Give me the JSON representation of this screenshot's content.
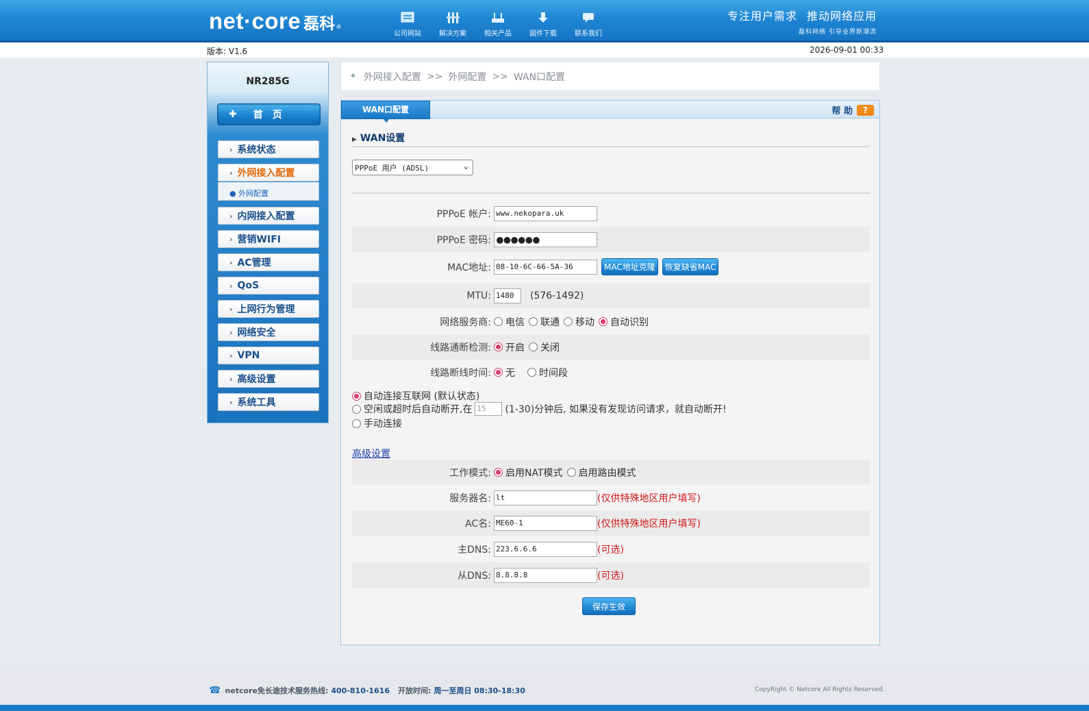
{
  "header": {
    "brand": "net·core",
    "brand_cn": "磊科",
    "reg_mark": "®",
    "nav": [
      {
        "label": "公司网站",
        "icon": "website-icon"
      },
      {
        "label": "解决方案",
        "icon": "tools-icon"
      },
      {
        "label": "相关产品",
        "icon": "router-icon"
      },
      {
        "label": "固件下载",
        "icon": "download-icon"
      },
      {
        "label": "联系我们",
        "icon": "chat-icon"
      }
    ],
    "slogan_1a": "专注用户需求",
    "slogan_1b": "推动网络应用",
    "slogan_2": "磊科网络 引导业界新潮流"
  },
  "infobar": {
    "version": "版本: V1.6",
    "datetime": "2026-09-01 00:33"
  },
  "sidebar": {
    "model": "NR285G",
    "home_label": "首　页",
    "items": [
      {
        "label": "系统状态",
        "active": false
      },
      {
        "label": "外网接入配置",
        "active": true
      },
      {
        "label": "内网接入配置",
        "active": false
      },
      {
        "label": "营销WIFI",
        "active": false
      },
      {
        "label": "AC管理",
        "active": false
      },
      {
        "label": "QoS",
        "active": false
      },
      {
        "label": "上网行为管理",
        "active": false
      },
      {
        "label": "网络安全",
        "active": false
      },
      {
        "label": "VPN",
        "active": false
      },
      {
        "label": "高级设置",
        "active": false
      },
      {
        "label": "系统工具",
        "active": false
      }
    ],
    "submenu_label": "● 外网配置"
  },
  "breadcrumb": {
    "crumbs": [
      "外网接入配置",
      "外网配置",
      "WAN口配置"
    ],
    "sep": ">>"
  },
  "panel": {
    "tab_label": "WAN口配置",
    "help_label": "帮 助",
    "help_icon": "?",
    "section_title": "WAN设置",
    "connection_type": "PPPoE 用户 (ADSL)",
    "pppoe_account_label": "PPPoE 帐户:",
    "pppoe_account": "www.nekopara.uk",
    "pppoe_password_label": "PPPoE 密码:",
    "pppoe_password": "●●●●●●",
    "mac_label": "MAC地址:",
    "mac": "08-10-6C-66-5A-36",
    "mac_clone_btn": "MAC地址克隆",
    "mac_restore_btn": "恢复缺省MAC",
    "mtu_label": "MTU:",
    "mtu": "1480",
    "mtu_range": "(576-1492)",
    "isp_label": "网络服务商:",
    "isp_options": [
      {
        "label": "电信",
        "selected": false
      },
      {
        "label": "联通",
        "selected": false
      },
      {
        "label": "移动",
        "selected": false
      },
      {
        "label": "自动识别",
        "selected": true
      }
    ],
    "link_detect_label": "线路通断检测:",
    "link_detect_options": [
      {
        "label": "开启",
        "selected": true
      },
      {
        "label": "关闭",
        "selected": false
      }
    ],
    "disconnect_time_label": "线路断线时间:",
    "disconnect_time_options": [
      {
        "label": "无",
        "selected": true
      },
      {
        "label": "时间段",
        "selected": false
      }
    ],
    "conn_mode_auto": "自动连接互联网 (默认状态)",
    "conn_mode_idle_prefix": "空闲或超时后自动断开,在",
    "idle_minutes": "15",
    "conn_mode_idle_suffix": "(1-30)分钟后, 如果没有发现访问请求，就自动断开!",
    "conn_mode_manual": "手动连接",
    "conn_mode_selected": "auto",
    "advanced_link": "高级设置",
    "work_mode_label": "工作模式:",
    "work_mode_options": [
      {
        "label": "启用NAT模式",
        "selected": true
      },
      {
        "label": "启用路由模式",
        "selected": false
      }
    ],
    "server_name_label": "服务器名:",
    "server_name": "lt",
    "ac_name_label": "AC名:",
    "ac_name": "ME60-1",
    "special_hint": "(仅供特殊地区用户填写)",
    "primary_dns_label": "主DNS:",
    "primary_dns": "223.6.6.6",
    "secondary_dns_label": "从DNS:",
    "secondary_dns": "8.8.8.8",
    "optional_hint": "(可选)",
    "save_btn": "保存生效"
  },
  "footer": {
    "hotline_prefix": "netcore免长途技术服务热线:",
    "hotline": "400-810-1616",
    "hours_prefix": "开放时间:",
    "hours": "周一至周日 08:30-18:30",
    "copyright": "CopyRight © Netcore All Rights Reserved."
  }
}
